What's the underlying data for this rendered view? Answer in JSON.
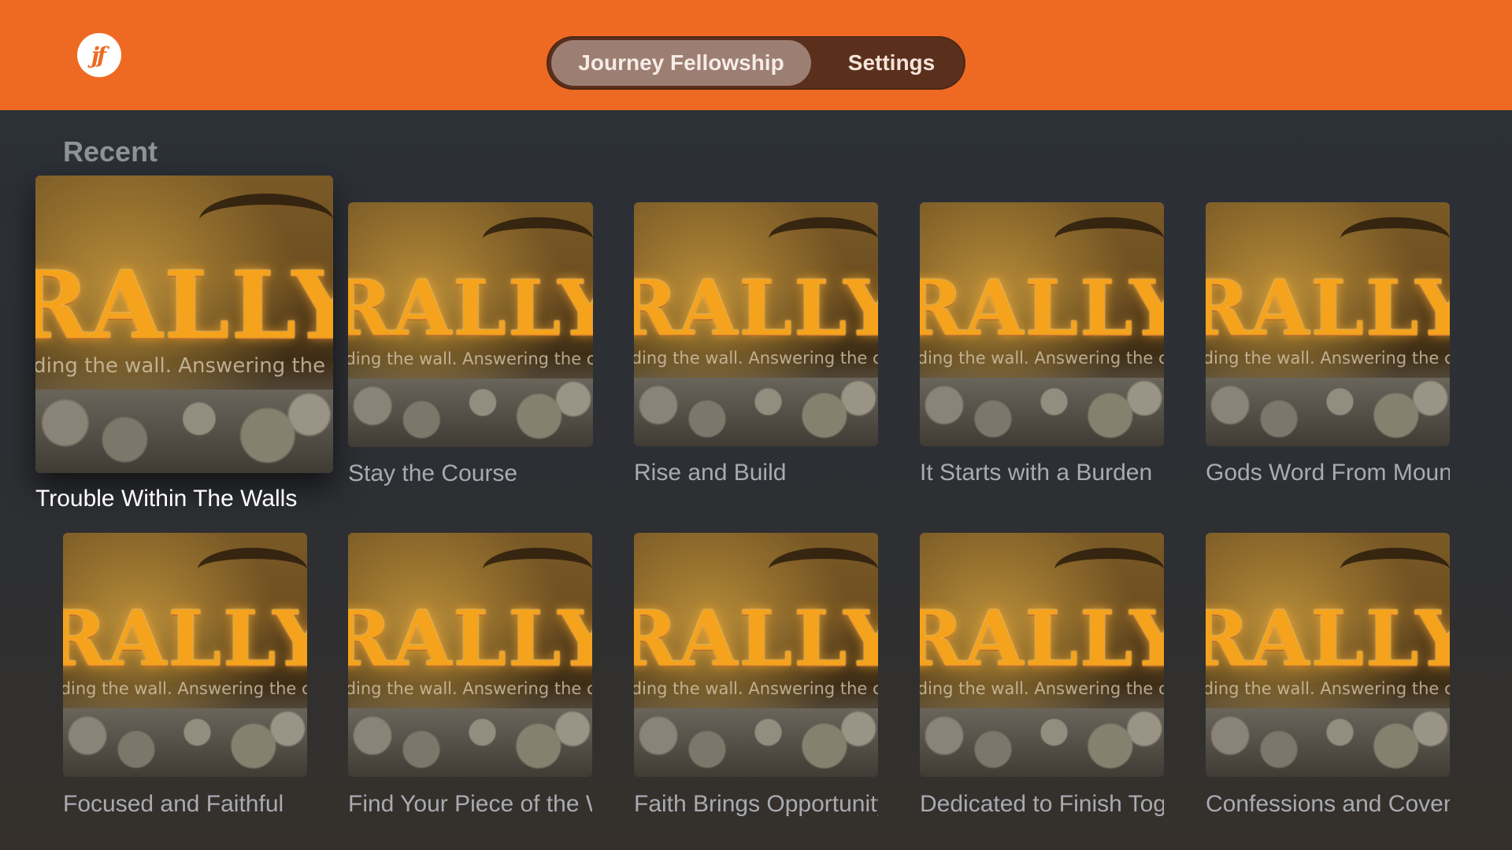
{
  "header": {
    "logo_text": "jf",
    "tabs": [
      {
        "label": "Journey Fellowship"
      },
      {
        "label": "Settings"
      }
    ]
  },
  "section": {
    "title": "Recent"
  },
  "artwork": {
    "word": "RALLY",
    "tagline": "Rebuilding the wall. Answering the call."
  },
  "episodes": [
    {
      "title": "Trouble Within The Walls"
    },
    {
      "title": "Stay the Course"
    },
    {
      "title": "Rise and Build"
    },
    {
      "title": "It Starts with a Burden"
    },
    {
      "title": "Gods Word From Mount"
    },
    {
      "title": "Focused and Faithful"
    },
    {
      "title": "Find Your Piece of the Wall"
    },
    {
      "title": "Faith Brings Opportunity"
    },
    {
      "title": "Dedicated to Finish Together"
    },
    {
      "title": "Confessions and Covenants"
    }
  ],
  "colors": {
    "header": "#ee6a23",
    "background": "#2a2d33",
    "label": "#a8abb1",
    "label_focused": "#ffffff"
  }
}
